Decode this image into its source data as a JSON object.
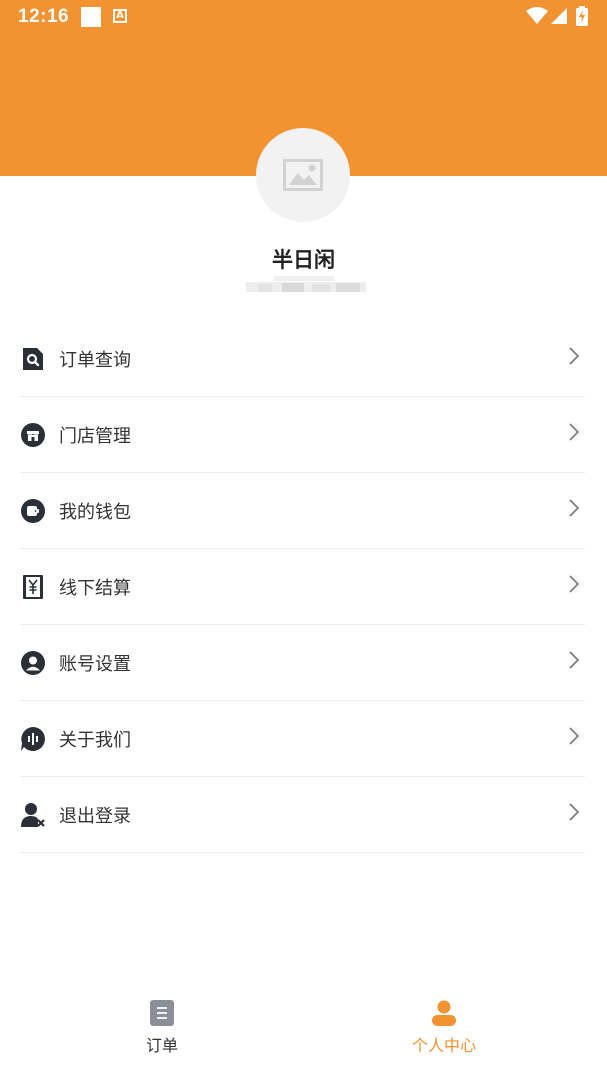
{
  "status_bar": {
    "time": "12:16",
    "icons": [
      "notification-square-icon",
      "a-letter-icon",
      "wifi-icon",
      "signal-icon",
      "battery-charging-icon"
    ],
    "a_glyph": "A"
  },
  "colors": {
    "accent": "#f29230",
    "dark_icon": "#2b2f38",
    "tab_inactive": "#8a8f9a",
    "text": "#333333"
  },
  "profile": {
    "avatar_icon": "image-placeholder-icon",
    "name": "半日闲",
    "id_text": ""
  },
  "menu": {
    "items": [
      {
        "label": "订单查询",
        "icon": "order-search-icon"
      },
      {
        "label": "门店管理",
        "icon": "store-icon"
      },
      {
        "label": "我的钱包",
        "icon": "wallet-icon"
      },
      {
        "label": "线下结算",
        "icon": "yuan-ledger-icon"
      },
      {
        "label": "账号设置",
        "icon": "account-icon"
      },
      {
        "label": "关于我们",
        "icon": "about-icon"
      },
      {
        "label": "退出登录",
        "icon": "logout-user-icon"
      }
    ]
  },
  "tabbar": {
    "tabs": [
      {
        "label": "订单",
        "icon": "order-list-icon",
        "active": false
      },
      {
        "label": "个人中心",
        "icon": "person-icon",
        "active": true
      }
    ]
  }
}
